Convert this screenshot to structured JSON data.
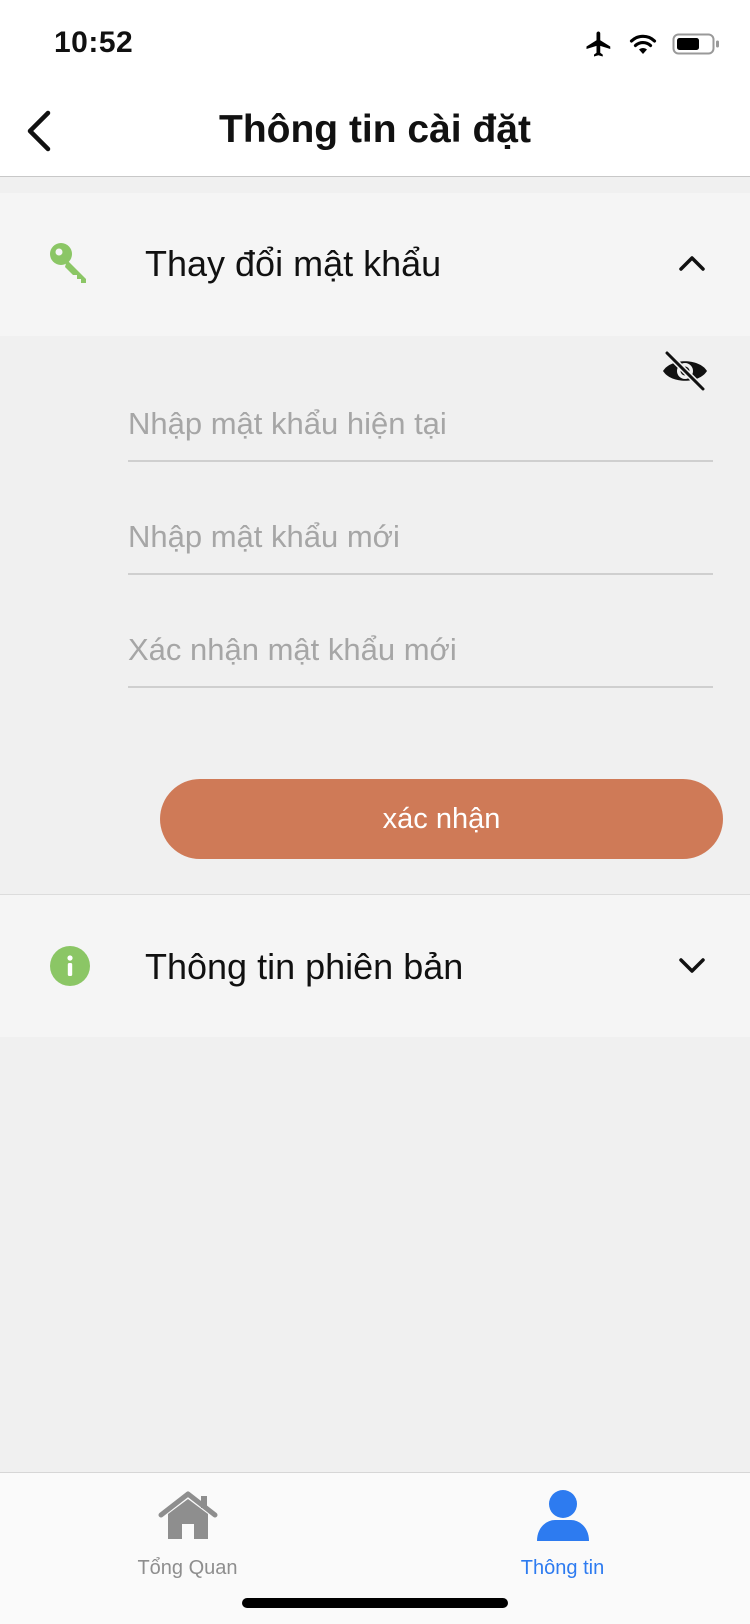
{
  "status_bar": {
    "time": "10:52"
  },
  "header": {
    "title": "Thông tin cài đặt"
  },
  "password_section": {
    "title": "Thay đổi mật khẩu",
    "current_placeholder": "Nhập mật khẩu hiện tại",
    "new_placeholder": "Nhập mật khẩu mới",
    "confirm_placeholder": "Xác nhận mật khẩu mới",
    "submit_label": "xác nhận"
  },
  "version_section": {
    "title": "Thông tin phiên bản"
  },
  "tabs": [
    {
      "label": "Tổng Quan",
      "icon": "home-icon",
      "active": false
    },
    {
      "label": "Thông tin",
      "icon": "user-icon",
      "active": true
    }
  ],
  "colors": {
    "accent_green": "#8bc665",
    "button": "#cf7a57",
    "active_tab": "#2d7bf0",
    "inactive_tab": "#8e8e8e"
  }
}
